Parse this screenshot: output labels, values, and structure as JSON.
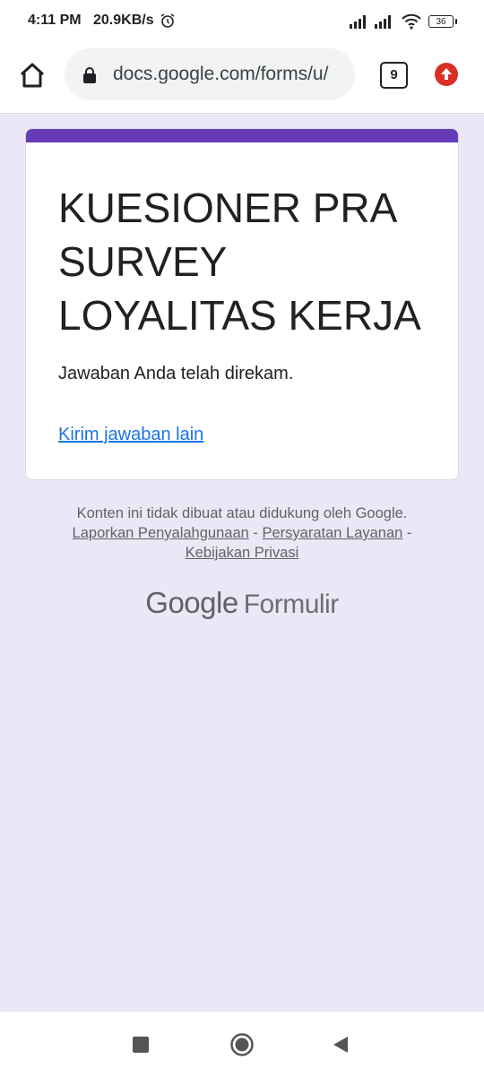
{
  "status_bar": {
    "time": "4:11 PM",
    "speed": "20.9KB/s",
    "battery": "36"
  },
  "browser": {
    "url": "docs.google.com/forms/u/",
    "tab_count": "9"
  },
  "form": {
    "title": "KUESIONER PRA SURVEY LOYALITAS KERJA",
    "confirmation": "Jawaban Anda telah direkam.",
    "another_response": "Kirim jawaban lain",
    "accent_color": "#673ab7"
  },
  "footer": {
    "disclaimer": "Konten ini tidak dibuat atau didukung oleh Google.",
    "report_abuse": "Laporkan Penyalahgunaan",
    "sep1": " - ",
    "terms": "Persyaratan Layanan",
    "sep2": " -",
    "privacy": "Kebijakan Privasi",
    "brand_google": "Google",
    "brand_product": "Formulir"
  }
}
